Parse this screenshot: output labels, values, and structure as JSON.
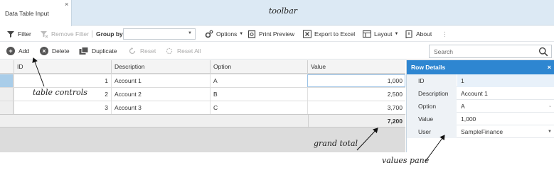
{
  "tab": {
    "label": "Data Table Input",
    "close": "×"
  },
  "annotations": {
    "toolbar": "toolbar",
    "table_controls": "table controls",
    "grand_total": "grand total",
    "values_pane": "values pane"
  },
  "toolbar": {
    "filter": "Filter",
    "remove_filter": "Remove Filter",
    "group_by": "Group by",
    "group_by_value": "",
    "options": "Options",
    "print_preview": "Print Preview",
    "export": "Export to Excel",
    "layout": "Layout",
    "about": "About",
    "more": "⋮"
  },
  "actions": {
    "add": "Add",
    "delete": "Delete",
    "duplicate": "Duplicate",
    "reset": "Reset",
    "reset_all": "Reset All",
    "search_placeholder": "Search"
  },
  "grid": {
    "columns": [
      "ID",
      "Description",
      "Option",
      "Value"
    ],
    "rows": [
      {
        "id": "1",
        "description": "Account 1",
        "option": "A",
        "value": "1,000"
      },
      {
        "id": "2",
        "description": "Account 2",
        "option": "B",
        "value": "2,500"
      },
      {
        "id": "3",
        "description": "Account 3",
        "option": "C",
        "value": "3,700"
      }
    ],
    "total": "7,200"
  },
  "details": {
    "title": "Row Details",
    "close": "×",
    "fields": [
      {
        "label": "ID",
        "value": "1"
      },
      {
        "label": "Description",
        "value": "Account 1"
      },
      {
        "label": "Option",
        "value": "A"
      },
      {
        "label": "Value",
        "value": "1,000"
      },
      {
        "label": "User",
        "value": "SampleFinance"
      }
    ]
  },
  "colors": {
    "accent": "#2e86d1",
    "tabstrip": "#dce9f4",
    "selected_row": "#a9cde9"
  }
}
